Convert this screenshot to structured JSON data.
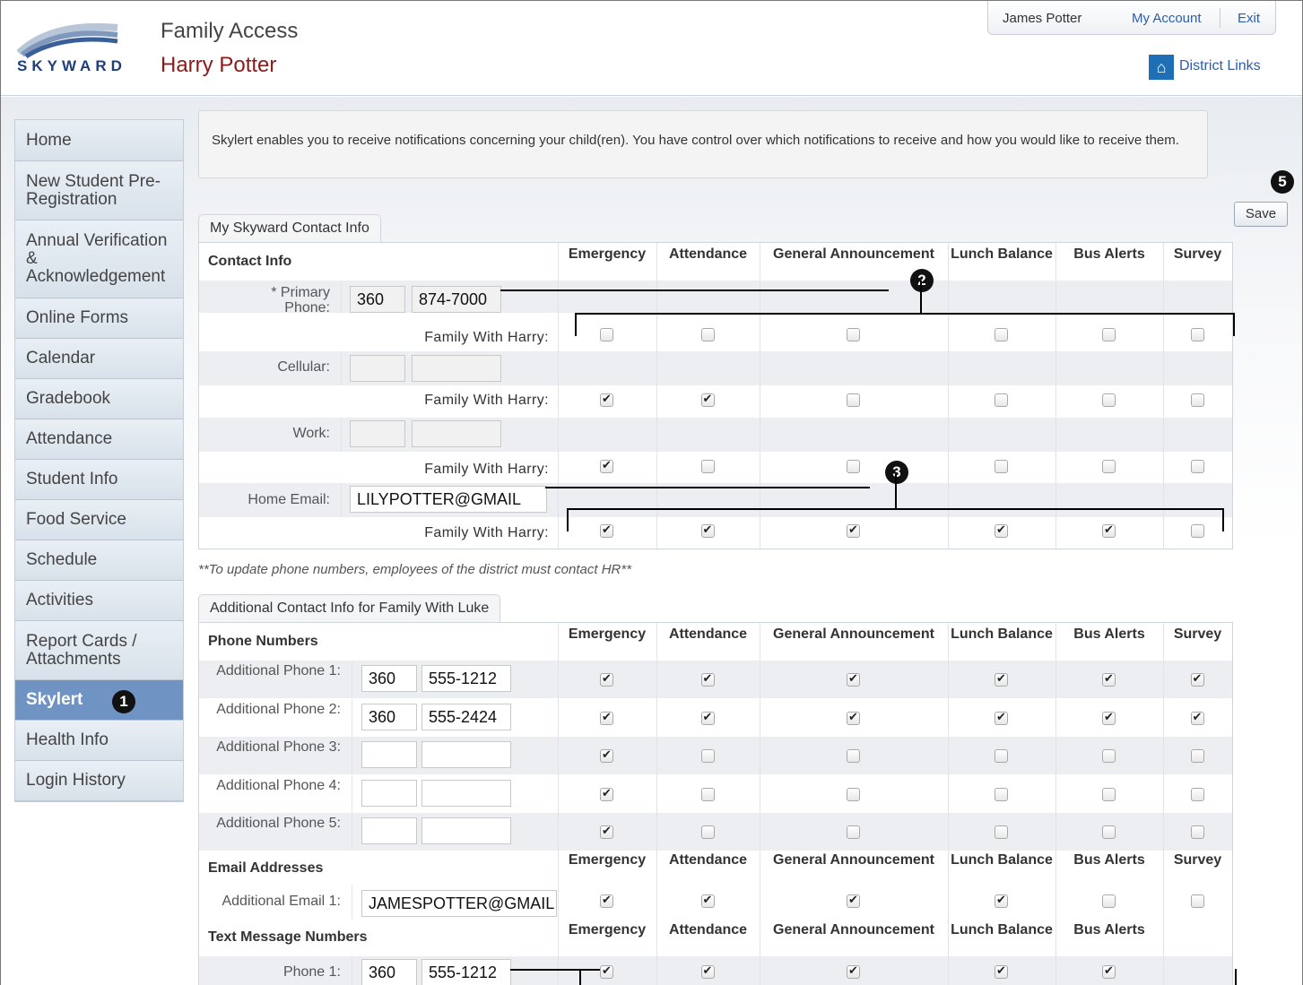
{
  "header": {
    "app_title": "Family Access",
    "student_name": "Harry Potter",
    "logo_text": "SKYWARD",
    "user": "James Potter",
    "my_account": "My Account",
    "exit": "Exit",
    "district_links": "District Links"
  },
  "sidebar": {
    "items": [
      {
        "label": "Home"
      },
      {
        "label": "New Student Pre-Registration"
      },
      {
        "label": "Annual Verification & Acknowledgement"
      },
      {
        "label": "Online Forms"
      },
      {
        "label": "Calendar"
      },
      {
        "label": "Gradebook"
      },
      {
        "label": "Attendance"
      },
      {
        "label": "Student Info"
      },
      {
        "label": "Food Service"
      },
      {
        "label": "Schedule"
      },
      {
        "label": "Activities"
      },
      {
        "label": "Report Cards / Attachments"
      },
      {
        "label": "Skylert"
      },
      {
        "label": "Health Info"
      },
      {
        "label": "Login History"
      }
    ],
    "active": "Skylert"
  },
  "info_text": "Skylert enables you to receive notifications concerning your child(ren). You have control over which notifications to receive and how you would like to receive them.",
  "save_label": "Save",
  "columns": [
    "Emergency",
    "Attendance",
    "General Announcement",
    "Lunch Balance",
    "Bus Alerts",
    "Survey"
  ],
  "contact": {
    "tab": "My Skyward Contact Info",
    "heading": "Contact Info",
    "primary_label": "* Primary Phone:",
    "primary_area": "360",
    "primary_number": "874-7000",
    "cellular_label": "Cellular:",
    "work_label": "Work:",
    "email_label": "Home Email:",
    "email_value": "LILYPOTTER@GMAIL",
    "family_label": "Family With Harry:",
    "rows": [
      [
        false,
        false,
        false,
        false,
        false,
        false
      ],
      [
        true,
        true,
        false,
        false,
        false,
        false
      ],
      [
        true,
        false,
        false,
        false,
        false,
        false
      ],
      [
        true,
        true,
        true,
        true,
        true,
        false
      ]
    ]
  },
  "note": "**To update phone numbers, employees of the district must contact HR**",
  "additional": {
    "tab": "Additional Contact Info for Family With Luke",
    "phone_heading": "Phone Numbers",
    "phones": [
      {
        "label": "Additional Phone 1:",
        "area": "360",
        "number": "555-1212",
        "checks": [
          true,
          true,
          true,
          true,
          true,
          true
        ]
      },
      {
        "label": "Additional Phone 2:",
        "area": "360",
        "number": "555-2424",
        "checks": [
          true,
          true,
          true,
          true,
          true,
          true
        ]
      },
      {
        "label": "Additional Phone 3:",
        "area": "",
        "number": "",
        "checks": [
          true,
          false,
          false,
          false,
          false,
          false
        ]
      },
      {
        "label": "Additional Phone 4:",
        "area": "",
        "number": "",
        "checks": [
          true,
          false,
          false,
          false,
          false,
          false
        ]
      },
      {
        "label": "Additional Phone 5:",
        "area": "",
        "number": "",
        "checks": [
          true,
          false,
          false,
          false,
          false,
          false
        ]
      }
    ],
    "email_heading": "Email Addresses",
    "email_label": "Additional Email 1:",
    "email_value": "JAMESPOTTER@GMAIL",
    "email_checks": [
      true,
      true,
      true,
      true,
      false,
      false
    ],
    "text_heading": "Text Message Numbers",
    "text_label": "Phone 1:",
    "text_area": "360",
    "text_number": "555-1212",
    "text_checks": [
      true,
      true,
      true,
      true,
      true
    ]
  },
  "callouts": [
    "1",
    "2",
    "3",
    "5"
  ]
}
